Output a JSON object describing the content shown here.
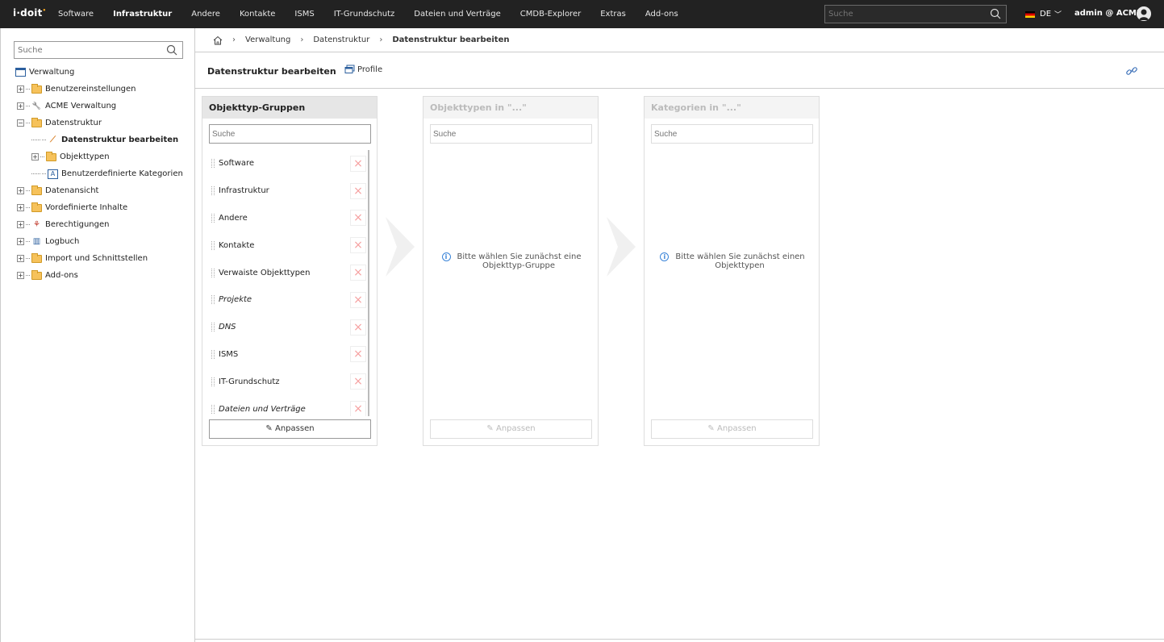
{
  "app": {
    "logo_text": "i·doit",
    "nav": [
      "Software",
      "Infrastruktur",
      "Andere",
      "Kontakte",
      "ISMS",
      "IT-Grundschutz",
      "Dateien und Verträge",
      "CMDB-Explorer",
      "Extras",
      "Add-ons"
    ],
    "nav_active": "Infrastruktur",
    "search_placeholder": "Suche",
    "language": "DE",
    "user": "admin @ ACME"
  },
  "sidebar": {
    "search_placeholder": "Suche",
    "tree": [
      {
        "label": "Verwaltung",
        "icon": "window-icon",
        "level": 0
      },
      {
        "label": "Benutzereinstellungen",
        "icon": "folder-icon",
        "level": 1
      },
      {
        "label": "ACME Verwaltung",
        "icon": "wrench-icon",
        "level": 1
      },
      {
        "label": "Datenstruktur",
        "icon": "folder-open-icon",
        "level": 1
      },
      {
        "label": "Datenstruktur bearbeiten",
        "icon": "wand-icon",
        "level": 2,
        "selected": true
      },
      {
        "label": "Objekttypen",
        "icon": "folder-icon",
        "level": 2
      },
      {
        "label": "Benutzerdefinierte Kategorien",
        "icon": "category-icon",
        "level": 2
      },
      {
        "label": "Datenansicht",
        "icon": "folder-icon",
        "level": 1
      },
      {
        "label": "Vordefinierte Inhalte",
        "icon": "folder-icon",
        "level": 1
      },
      {
        "label": "Berechtigungen",
        "icon": "permissions-icon",
        "level": 1
      },
      {
        "label": "Logbuch",
        "icon": "logbook-icon",
        "level": 1
      },
      {
        "label": "Import und Schnittstellen",
        "icon": "folder-icon",
        "level": 1
      },
      {
        "label": "Add-ons",
        "icon": "folder-icon",
        "level": 1
      }
    ]
  },
  "breadcrumb": [
    "Verwaltung",
    "Datenstruktur",
    "Datenstruktur bearbeiten"
  ],
  "page": {
    "title": "Datenstruktur bearbeiten",
    "profile_label": "Profile"
  },
  "panels": {
    "groups": {
      "title": "Objekttyp-Gruppen",
      "search_placeholder": "Suche",
      "adjust_label": "Anpassen",
      "items": [
        {
          "label": "Software",
          "italic": false
        },
        {
          "label": "Infrastruktur",
          "italic": false
        },
        {
          "label": "Andere",
          "italic": false
        },
        {
          "label": "Kontakte",
          "italic": false
        },
        {
          "label": "Verwaiste Objekttypen",
          "italic": false
        },
        {
          "label": "Projekte",
          "italic": true
        },
        {
          "label": "DNS",
          "italic": true
        },
        {
          "label": "ISMS",
          "italic": false
        },
        {
          "label": "IT-Grundschutz",
          "italic": false
        },
        {
          "label": "Dateien und Verträge",
          "italic": true
        }
      ]
    },
    "types": {
      "title": "Objekttypen in \"...\"",
      "search_placeholder": "Suche",
      "info": "Bitte wählen Sie zunächst eine Objekttyp-Gruppe",
      "info_line1": "Bitte wählen Sie zunächst eine",
      "info_line2": "Objekttyp-Gruppe",
      "adjust_label": "Anpassen"
    },
    "categories": {
      "title": "Kategorien in \"...\"",
      "search_placeholder": "Suche",
      "info_line1": "Bitte wählen Sie zunächst einen",
      "info_line2": "Objekttypen",
      "adjust_label": "Anpassen"
    }
  },
  "colors": {
    "topbar": "#222222",
    "folder": "#f6c25b",
    "delete_x": "#f6a0a0",
    "info": "#3a84d8"
  }
}
